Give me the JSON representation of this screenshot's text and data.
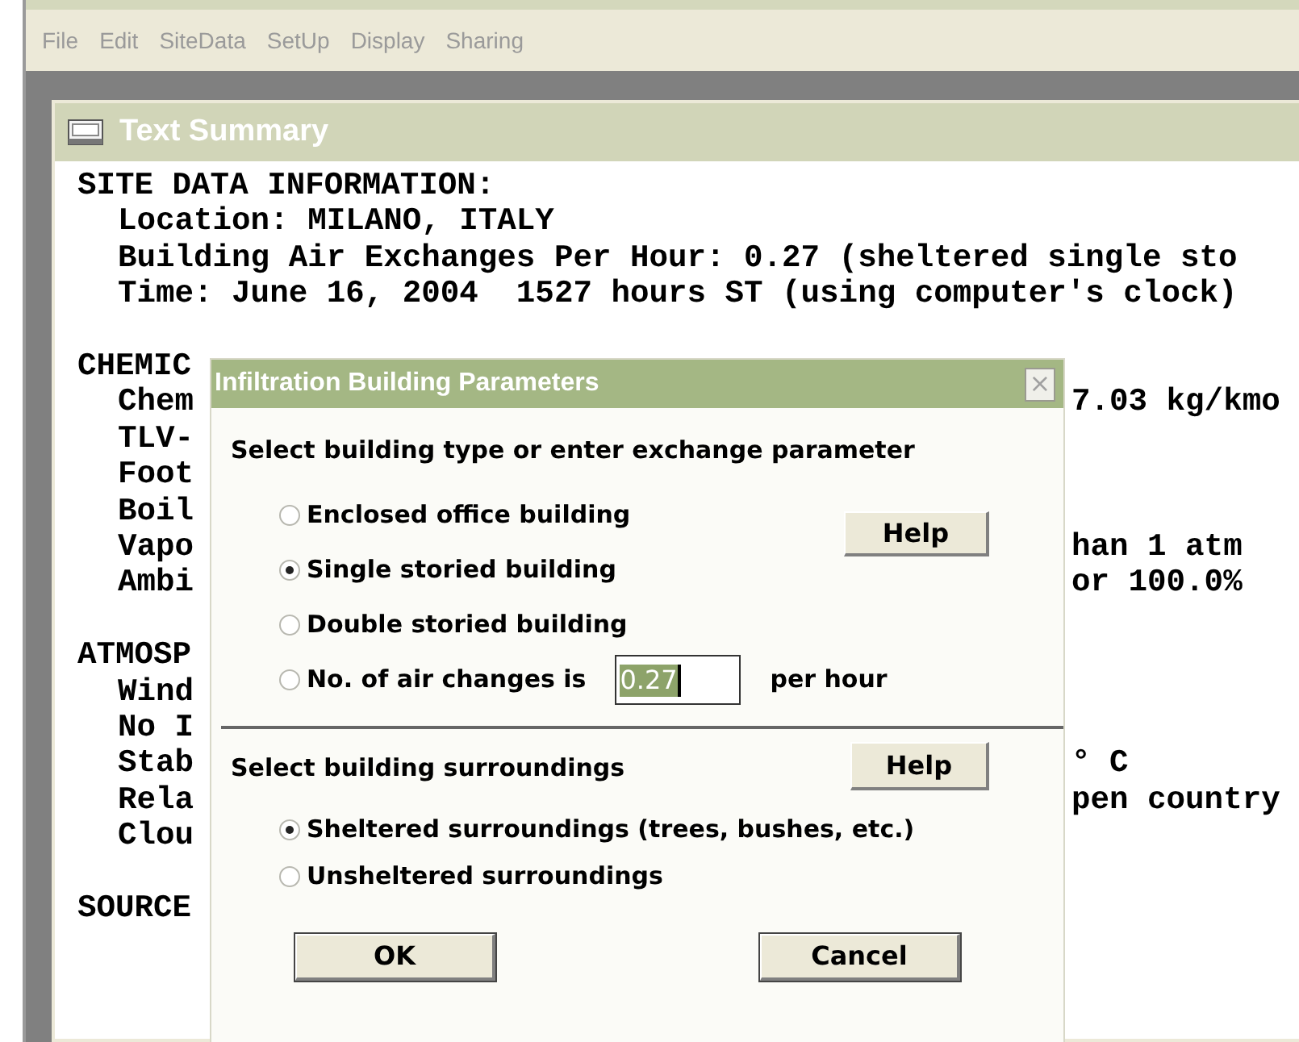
{
  "menu": [
    "File",
    "Edit",
    "SiteData",
    "SetUp",
    "Display",
    "Sharing"
  ],
  "summary_window": {
    "title": "Text Summary",
    "sections": [
      {
        "heading": {
          "text": "SITE DATA INFORMATION:"
        },
        "items": [
          {
            "text": "Location: MILANO, ITALY"
          },
          {
            "text": "Building Air Exchanges Per Hour: 0.27 (sheltered single sto"
          },
          {
            "text": "Time: June 16, 2004  1527 hours ST (using computer's clock)"
          }
        ]
      },
      {
        "heading": {
          "text": "CHEMIC"
        },
        "items": [
          {
            "text": "Chem",
            "right": "7.03 kg/kmo"
          },
          {
            "text": "TLV-"
          },
          {
            "text": "Foot"
          },
          {
            "text": "Boil"
          },
          {
            "text": "Vapo",
            "right": "han 1 atm"
          },
          {
            "text": "Ambi",
            "right": "or 100.0%"
          }
        ]
      },
      {
        "heading": {
          "text": "ATMOSP"
        },
        "items": [
          {
            "text": "Wind"
          },
          {
            "text": "No I"
          },
          {
            "text": "Stab",
            "right": "° C"
          },
          {
            "text": "Rela",
            "right": "pen country"
          },
          {
            "text": "Clou"
          }
        ]
      },
      {
        "heading": {
          "text": "SOURCE"
        }
      }
    ]
  },
  "dialog": {
    "title": "Infiltration Building Parameters",
    "close": "×",
    "building": {
      "prompt": "Select building type or enter exchange parameter",
      "help": "Help",
      "options": [
        {
          "label": "Enclosed office building",
          "selected": false
        },
        {
          "label": "Single storied building",
          "selected": true
        },
        {
          "label": "Double storied building",
          "selected": false
        },
        {
          "label": "No. of air changes is",
          "selected": false,
          "value": "0.27",
          "unit": "per hour"
        }
      ]
    },
    "surroundings": {
      "prompt": "Select building surroundings",
      "help": "Help",
      "options": [
        {
          "label": "Sheltered surroundings (trees, bushes, etc.)",
          "selected": true
        },
        {
          "label": "Unsheltered surroundings",
          "selected": false
        }
      ]
    },
    "buttons": [
      "OK",
      "Cancel"
    ]
  }
}
